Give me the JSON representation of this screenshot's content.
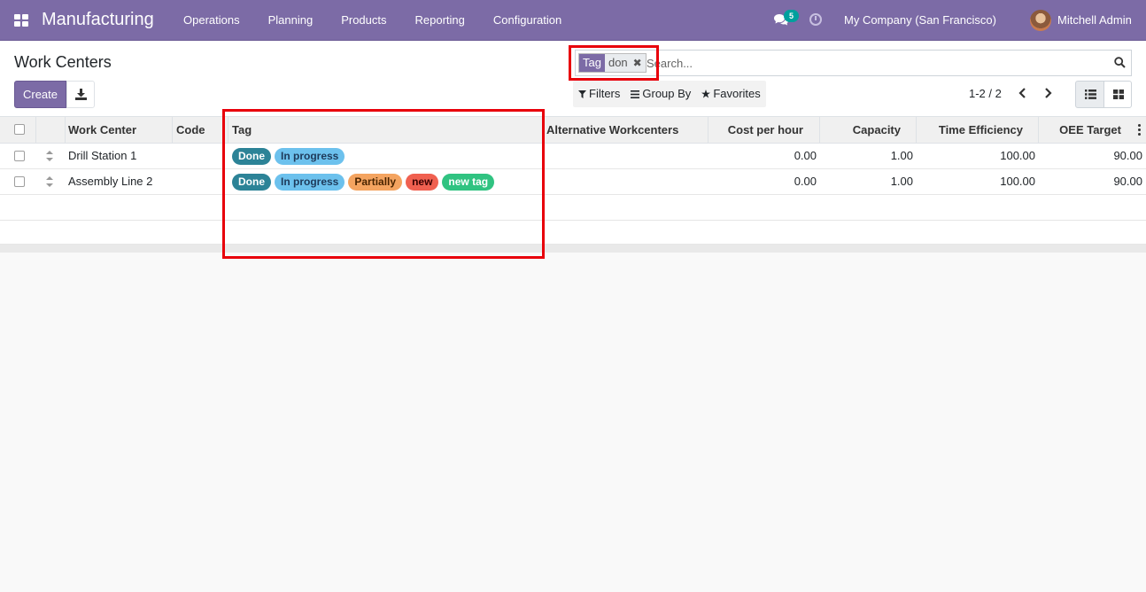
{
  "navbar": {
    "app_name": "Manufacturing",
    "menu": [
      "Operations",
      "Planning",
      "Products",
      "Reporting",
      "Configuration"
    ],
    "messages_badge": "5",
    "company": "My Company (San Francisco)",
    "user": "Mitchell Admin"
  },
  "control_panel": {
    "title": "Work Centers",
    "create_label": "Create",
    "search": {
      "facet_label": "Tag",
      "facet_value": "don",
      "placeholder": "Search..."
    },
    "filters_label": "Filters",
    "group_by_label": "Group By",
    "favorites_label": "Favorites",
    "pager": "1-2 / 2"
  },
  "table": {
    "columns": [
      "Work Center",
      "Code",
      "Tag",
      "Alternative Workcenters",
      "Cost per hour",
      "Capacity",
      "Time Efficiency",
      "OEE Target"
    ],
    "rows": [
      {
        "work_center": "Drill Station 1",
        "code": "",
        "tags": [
          {
            "label": "Done",
            "bg": "#2c8397",
            "fg": "#ffffff"
          },
          {
            "label": "In progress",
            "bg": "#6cc1ed",
            "fg": "#1e3a5a"
          }
        ],
        "alternative": "",
        "cost_per_hour": "0.00",
        "capacity": "1.00",
        "time_efficiency": "100.00",
        "oee_target": "90.00"
      },
      {
        "work_center": "Assembly Line 2",
        "code": "",
        "tags": [
          {
            "label": "Done",
            "bg": "#2c8397",
            "fg": "#ffffff"
          },
          {
            "label": "In progress",
            "bg": "#6cc1ed",
            "fg": "#1e3a5a"
          },
          {
            "label": "Partially",
            "bg": "#f4a460",
            "fg": "#4a2500"
          },
          {
            "label": "new",
            "bg": "#f06050",
            "fg": "#3a0000"
          },
          {
            "label": "new tag",
            "bg": "#30c381",
            "fg": "#ffffff"
          }
        ],
        "alternative": "",
        "cost_per_hour": "0.00",
        "capacity": "1.00",
        "time_efficiency": "100.00",
        "oee_target": "90.00"
      }
    ]
  },
  "colors": {
    "brand": "#7c6ba6",
    "highlight": "#e8000b"
  }
}
